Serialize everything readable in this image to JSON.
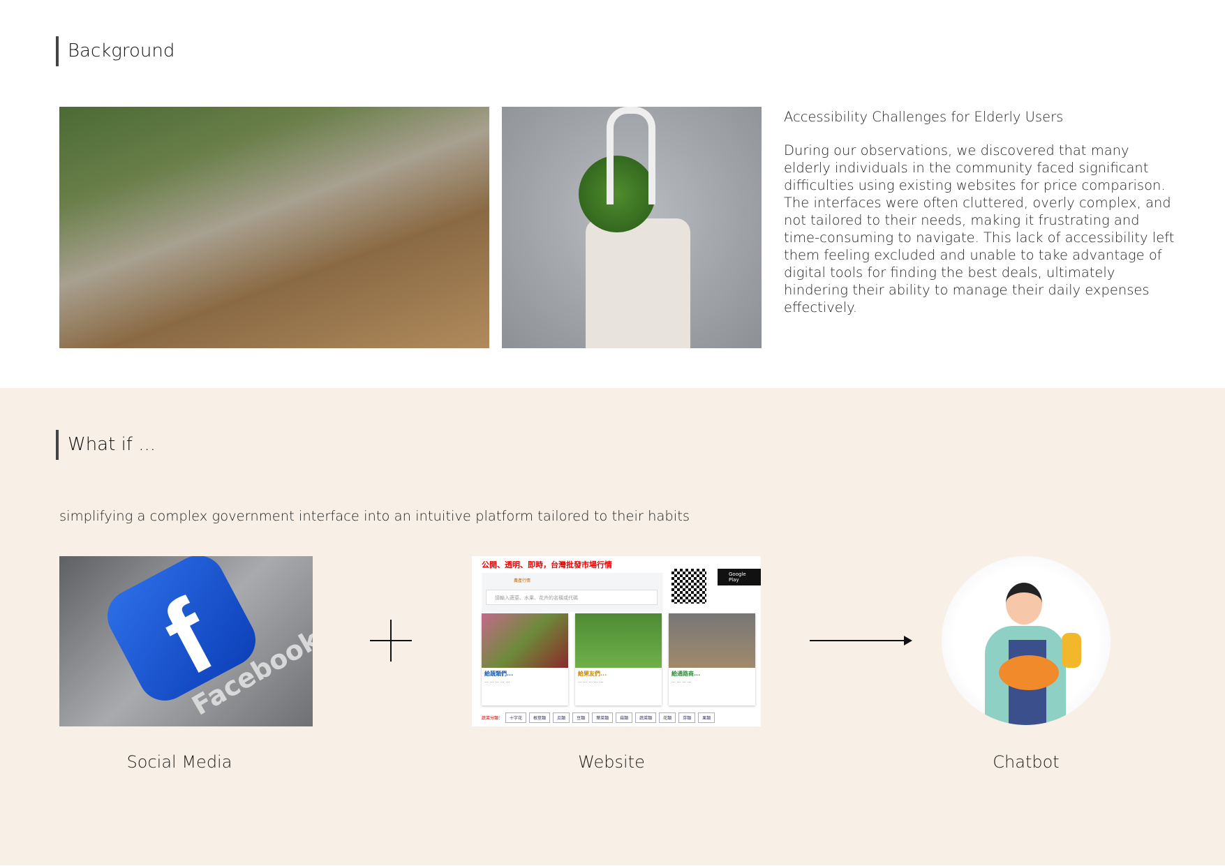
{
  "background": {
    "heading": "Background",
    "intro_title": "Accessibility Challenges for Elderly Users",
    "intro_body": "During our observations, we discovered that many elderly individuals in the community faced significant difficulties using existing websites for price comparison. The interfaces were often cluttered, overly complex, and not tailored to their needs, making it frustrating and time-consuming to navigate. This lack of accessibility left them feeling excluded and unable to take advantage of digital tools for finding the best deals, ultimately hindering their ability to manage their daily expenses effectively."
  },
  "whatif": {
    "heading": "What if ...",
    "subtitle": "simplifying a complex government interface into an intuitive platform tailored to their habits",
    "items": [
      {
        "label": "Social Media"
      },
      {
        "label": "Website"
      },
      {
        "label": "Chatbot"
      }
    ],
    "facebook_word": "Facebook",
    "website": {
      "title": "公開、透明、即時，台灣批發市場行情",
      "tab": "農產行情",
      "search_placeholder": "請輸入蔬菜、水果、花卉的名稱或代碼",
      "store_badge": "Google Play",
      "cards": [
        {
          "title": "給蔬類們...",
          "color": "#1a5fb4"
        },
        {
          "title": "給果友們...",
          "color": "#c88a00"
        },
        {
          "title": "給通路商...",
          "color": "#2e8b3a"
        }
      ],
      "category_label": "蔬菜分類：",
      "categories": [
        "十字花",
        "根莖類",
        "瓜類",
        "豆類",
        "葉菜類",
        "菇類",
        "蔬菜類",
        "花類",
        "芽類",
        "果類"
      ]
    },
    "accent": "#f8f0e6"
  }
}
